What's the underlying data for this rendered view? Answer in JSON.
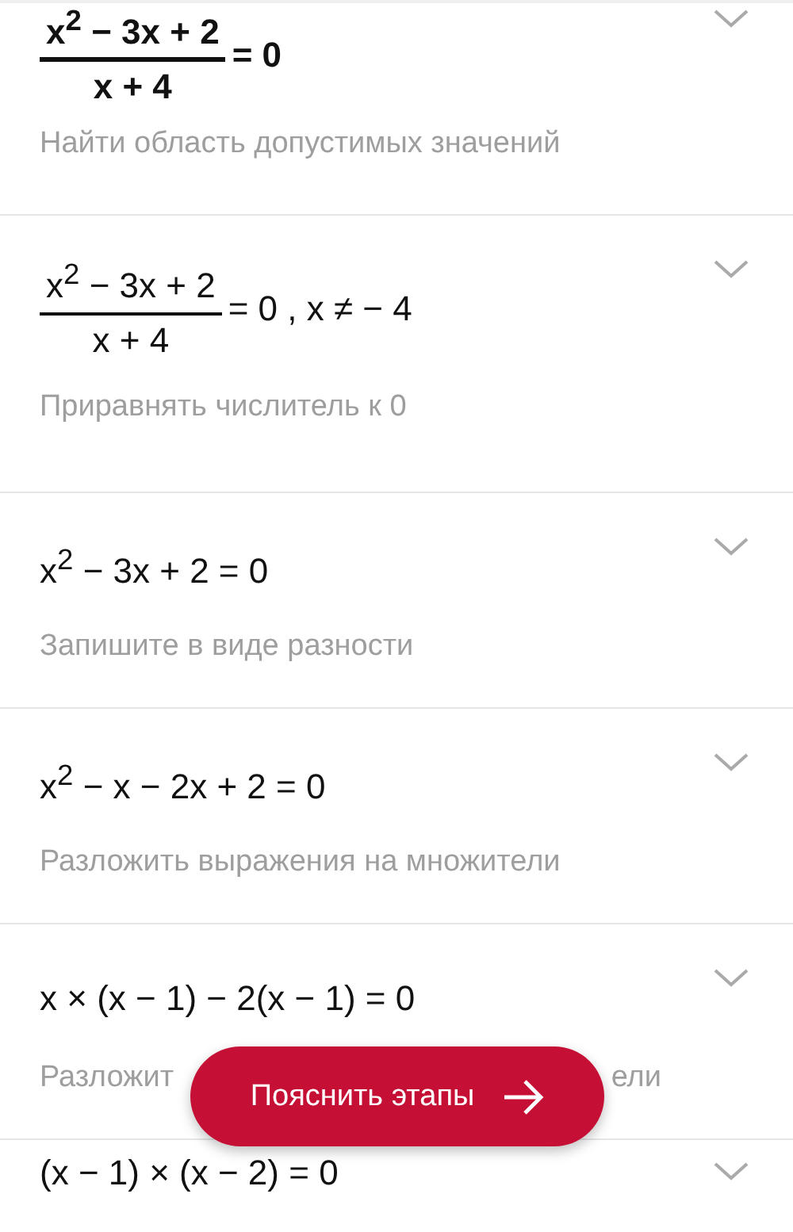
{
  "steps": [
    {
      "kind": "problem",
      "expression": {
        "kind": "fraction",
        "numerator": "x$^{2}$ − 3x + 2",
        "denominator": "x + 4",
        "rest": "= 0"
      },
      "description": "Найти область допустимых значений"
    },
    {
      "kind": "step",
      "expression": {
        "kind": "fraction",
        "numerator": "x$^{2}$ − 3x + 2",
        "denominator": "x + 4",
        "rest": "= 0 , x ≠ − 4"
      },
      "description": "Приравнять числитель к 0"
    },
    {
      "kind": "step",
      "expression": {
        "kind": "line",
        "text": "x$^{2}$ − 3x + 2 = 0"
      },
      "description": "Запишите в виде разности"
    },
    {
      "kind": "step",
      "expression": {
        "kind": "line",
        "text": "x$^{2}$ − x − 2x + 2 = 0"
      },
      "description": "Разложить выражения на множители"
    },
    {
      "kind": "step",
      "expression": {
        "kind": "line",
        "text": "x × (x − 1) − 2(x − 1) = 0"
      },
      "description_fragments": [
        "Разложит",
        "ели"
      ]
    },
    {
      "kind": "step",
      "expression": {
        "kind": "line",
        "text": "(x − 1) × (x − 2) = 0"
      }
    }
  ],
  "explain_button": {
    "label": "Пояснить этапы"
  }
}
